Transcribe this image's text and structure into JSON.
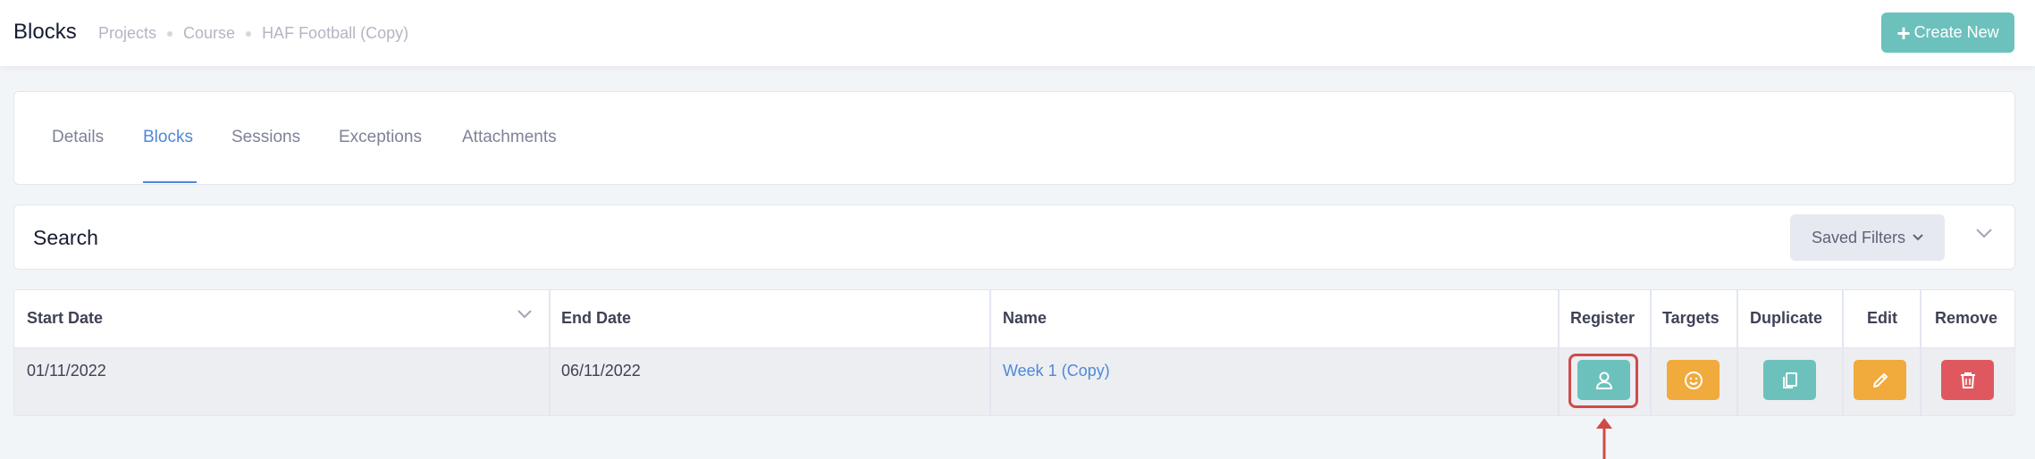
{
  "header": {
    "title": "Blocks",
    "breadcrumb": [
      "Projects",
      "Course",
      "HAF Football (Copy)"
    ],
    "create_button": "Create New"
  },
  "tabs": [
    {
      "label": "Details",
      "active": false
    },
    {
      "label": "Blocks",
      "active": true
    },
    {
      "label": "Sessions",
      "active": false
    },
    {
      "label": "Exceptions",
      "active": false
    },
    {
      "label": "Attachments",
      "active": false
    }
  ],
  "search": {
    "title": "Search",
    "saved_filters_label": "Saved Filters"
  },
  "table": {
    "columns": [
      "Start Date",
      "End Date",
      "Name",
      "Register",
      "Targets",
      "Duplicate",
      "Edit",
      "Remove"
    ],
    "rows": [
      {
        "start_date": "01/11/2022",
        "end_date": "06/11/2022",
        "name": "Week 1 (Copy)"
      }
    ]
  },
  "icons": {
    "register": "user-icon",
    "targets": "smiley-icon",
    "duplicate": "copy-icon",
    "edit": "pencil-icon",
    "remove": "trash-icon"
  },
  "colors": {
    "accent_teal": "#6cc1bd",
    "accent_orange": "#f1aa3c",
    "accent_red": "#e0585f",
    "link_blue": "#4f88d8",
    "highlight": "#cf4b4a"
  }
}
